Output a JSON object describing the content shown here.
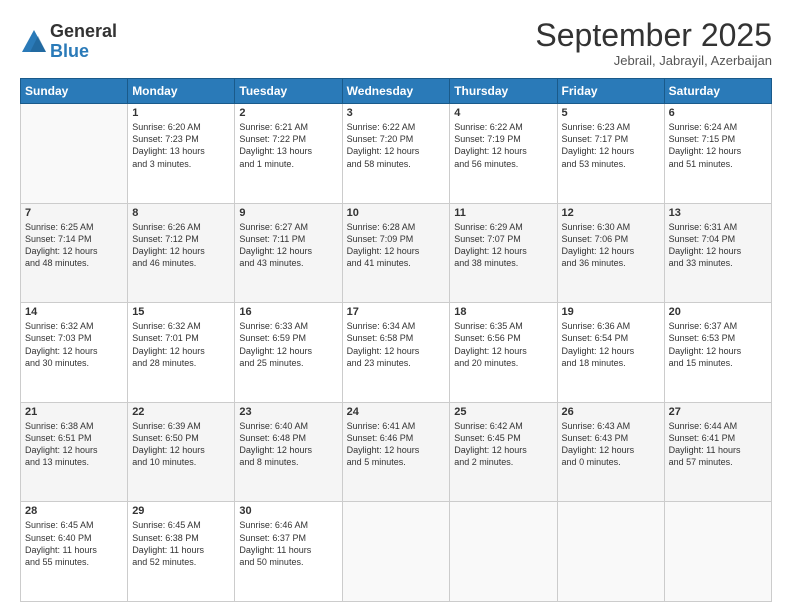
{
  "logo": {
    "general": "General",
    "blue": "Blue"
  },
  "header": {
    "month": "September 2025",
    "location": "Jebrail, Jabrayil, Azerbaijan"
  },
  "weekdays": [
    "Sunday",
    "Monday",
    "Tuesday",
    "Wednesday",
    "Thursday",
    "Friday",
    "Saturday"
  ],
  "weeks": [
    [
      {
        "day": "",
        "info": ""
      },
      {
        "day": "1",
        "info": "Sunrise: 6:20 AM\nSunset: 7:23 PM\nDaylight: 13 hours\nand 3 minutes."
      },
      {
        "day": "2",
        "info": "Sunrise: 6:21 AM\nSunset: 7:22 PM\nDaylight: 13 hours\nand 1 minute."
      },
      {
        "day": "3",
        "info": "Sunrise: 6:22 AM\nSunset: 7:20 PM\nDaylight: 12 hours\nand 58 minutes."
      },
      {
        "day": "4",
        "info": "Sunrise: 6:22 AM\nSunset: 7:19 PM\nDaylight: 12 hours\nand 56 minutes."
      },
      {
        "day": "5",
        "info": "Sunrise: 6:23 AM\nSunset: 7:17 PM\nDaylight: 12 hours\nand 53 minutes."
      },
      {
        "day": "6",
        "info": "Sunrise: 6:24 AM\nSunset: 7:15 PM\nDaylight: 12 hours\nand 51 minutes."
      }
    ],
    [
      {
        "day": "7",
        "info": "Sunrise: 6:25 AM\nSunset: 7:14 PM\nDaylight: 12 hours\nand 48 minutes."
      },
      {
        "day": "8",
        "info": "Sunrise: 6:26 AM\nSunset: 7:12 PM\nDaylight: 12 hours\nand 46 minutes."
      },
      {
        "day": "9",
        "info": "Sunrise: 6:27 AM\nSunset: 7:11 PM\nDaylight: 12 hours\nand 43 minutes."
      },
      {
        "day": "10",
        "info": "Sunrise: 6:28 AM\nSunset: 7:09 PM\nDaylight: 12 hours\nand 41 minutes."
      },
      {
        "day": "11",
        "info": "Sunrise: 6:29 AM\nSunset: 7:07 PM\nDaylight: 12 hours\nand 38 minutes."
      },
      {
        "day": "12",
        "info": "Sunrise: 6:30 AM\nSunset: 7:06 PM\nDaylight: 12 hours\nand 36 minutes."
      },
      {
        "day": "13",
        "info": "Sunrise: 6:31 AM\nSunset: 7:04 PM\nDaylight: 12 hours\nand 33 minutes."
      }
    ],
    [
      {
        "day": "14",
        "info": "Sunrise: 6:32 AM\nSunset: 7:03 PM\nDaylight: 12 hours\nand 30 minutes."
      },
      {
        "day": "15",
        "info": "Sunrise: 6:32 AM\nSunset: 7:01 PM\nDaylight: 12 hours\nand 28 minutes."
      },
      {
        "day": "16",
        "info": "Sunrise: 6:33 AM\nSunset: 6:59 PM\nDaylight: 12 hours\nand 25 minutes."
      },
      {
        "day": "17",
        "info": "Sunrise: 6:34 AM\nSunset: 6:58 PM\nDaylight: 12 hours\nand 23 minutes."
      },
      {
        "day": "18",
        "info": "Sunrise: 6:35 AM\nSunset: 6:56 PM\nDaylight: 12 hours\nand 20 minutes."
      },
      {
        "day": "19",
        "info": "Sunrise: 6:36 AM\nSunset: 6:54 PM\nDaylight: 12 hours\nand 18 minutes."
      },
      {
        "day": "20",
        "info": "Sunrise: 6:37 AM\nSunset: 6:53 PM\nDaylight: 12 hours\nand 15 minutes."
      }
    ],
    [
      {
        "day": "21",
        "info": "Sunrise: 6:38 AM\nSunset: 6:51 PM\nDaylight: 12 hours\nand 13 minutes."
      },
      {
        "day": "22",
        "info": "Sunrise: 6:39 AM\nSunset: 6:50 PM\nDaylight: 12 hours\nand 10 minutes."
      },
      {
        "day": "23",
        "info": "Sunrise: 6:40 AM\nSunset: 6:48 PM\nDaylight: 12 hours\nand 8 minutes."
      },
      {
        "day": "24",
        "info": "Sunrise: 6:41 AM\nSunset: 6:46 PM\nDaylight: 12 hours\nand 5 minutes."
      },
      {
        "day": "25",
        "info": "Sunrise: 6:42 AM\nSunset: 6:45 PM\nDaylight: 12 hours\nand 2 minutes."
      },
      {
        "day": "26",
        "info": "Sunrise: 6:43 AM\nSunset: 6:43 PM\nDaylight: 12 hours\nand 0 minutes."
      },
      {
        "day": "27",
        "info": "Sunrise: 6:44 AM\nSunset: 6:41 PM\nDaylight: 11 hours\nand 57 minutes."
      }
    ],
    [
      {
        "day": "28",
        "info": "Sunrise: 6:45 AM\nSunset: 6:40 PM\nDaylight: 11 hours\nand 55 minutes."
      },
      {
        "day": "29",
        "info": "Sunrise: 6:45 AM\nSunset: 6:38 PM\nDaylight: 11 hours\nand 52 minutes."
      },
      {
        "day": "30",
        "info": "Sunrise: 6:46 AM\nSunset: 6:37 PM\nDaylight: 11 hours\nand 50 minutes."
      },
      {
        "day": "",
        "info": ""
      },
      {
        "day": "",
        "info": ""
      },
      {
        "day": "",
        "info": ""
      },
      {
        "day": "",
        "info": ""
      }
    ]
  ]
}
